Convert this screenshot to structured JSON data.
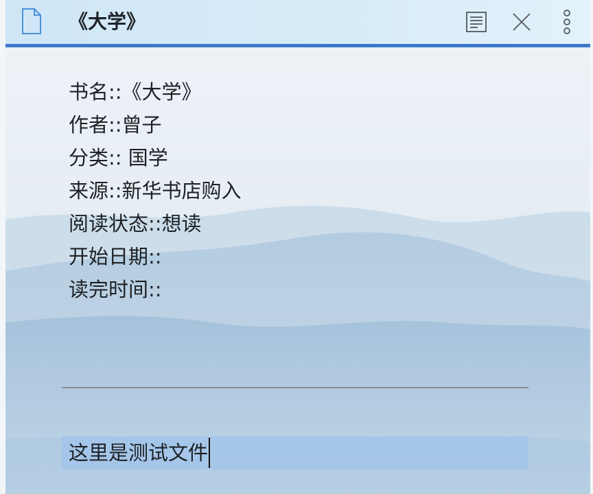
{
  "window": {
    "title": "《大学》",
    "accent_color": "#3a78c9"
  },
  "toolbar": {
    "icons": [
      "document-icon",
      "outline-icon",
      "close-icon",
      "more-vertical-icon"
    ]
  },
  "properties": [
    "书名::《大学》",
    "作者::曾子",
    "分类:: 国学",
    "来源::新华书店购入",
    "阅读状态::想读",
    "开始日期::",
    "读完时间::"
  ],
  "editor": {
    "current_line": "这里是测试文件"
  }
}
